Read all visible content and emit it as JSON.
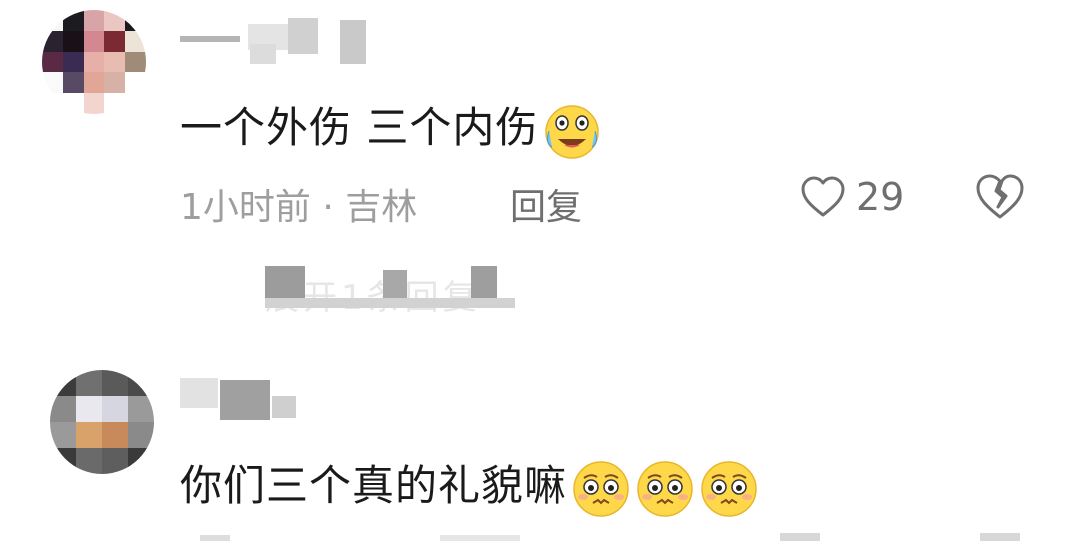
{
  "comments": [
    {
      "text": "一个外伤 三个内伤",
      "emoji": "crying-laughing-emoji",
      "meta": "1小时前 · 吉林",
      "reply_label": "回复",
      "like_count": "29",
      "expand_label": "展开1条回复"
    },
    {
      "text": "你们三个真的礼貌嘛",
      "emoji": "pleading-face-emoji",
      "emoji_count": 3
    }
  ],
  "colors": {
    "text": "#1a1a1a",
    "meta": "#9e9e9e",
    "action": "#6f6f6f",
    "emoji_face": "#ffd84a"
  },
  "icons": {
    "like": "heart-outline-icon",
    "dislike": "broken-heart-icon"
  }
}
